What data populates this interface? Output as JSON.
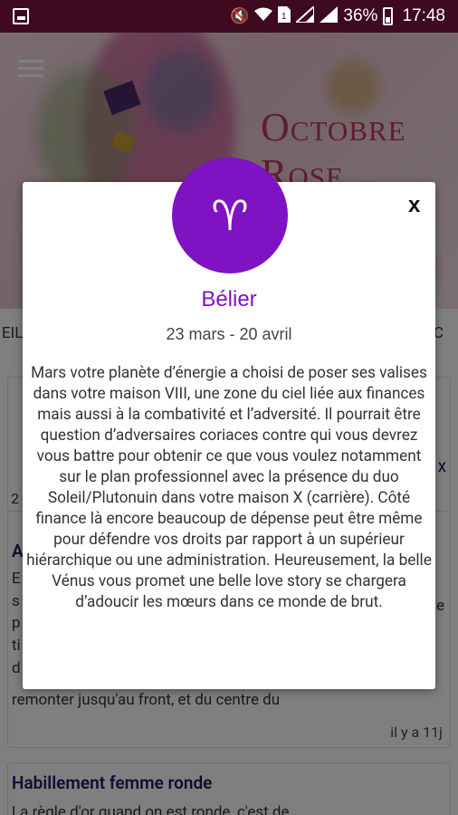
{
  "status_bar": {
    "battery_percent": "36%",
    "time": "17:48",
    "icons": [
      "image-notification-icon",
      "mute-icon",
      "wifi-icon",
      "sim-1-icon",
      "signal-icon",
      "signal-icon",
      "battery-icon"
    ]
  },
  "background": {
    "hero_title_line1": "Octobre",
    "hero_title_line2": "Rose",
    "tab_left": "EIL",
    "tab_right": "C",
    "card1": {
      "fragment_mid": "x",
      "fragment_left": "2"
    },
    "card2": {
      "title_fragment": "A",
      "body_last_line": "remonter jusqu'au front, et du centre du",
      "time_ago": "il y a 11j",
      "side_letters": [
        "E",
        "s",
        "p",
        "ti",
        "d"
      ],
      "right_fragment": "e"
    },
    "card3": {
      "title": "Habillement femme ronde",
      "body_first_line": "La règle d'or quand on est ronde, c'est de"
    }
  },
  "modal": {
    "sign_glyph": "♈",
    "close_label": "x",
    "sign_name": "Bélier",
    "dates": "23 mars - 20 avril",
    "text": "Mars votre planète d’énergie a choisi de poser ses valises dans votre maison VIII, une zone du ciel liée aux finances mais aussi à la combativité et l’adversité. Il pourrait être question d’adversaires coriaces contre qui vous devrez vous battre pour obtenir ce que vous voulez notamment sur le plan professionnel avec la présence du duo Soleil/Plutonuin dans votre maison X (carrière). Côté finance là encore beaucoup de dépense peut être même pour défendre vos droits par rapport à un supérieur hiérarchique ou une administration. Heureusement, la belle Vénus vous promet une belle love story se chargera d’adoucir les mœurs dans ce monde de brut.",
    "accent_color": "#7f12c2"
  }
}
